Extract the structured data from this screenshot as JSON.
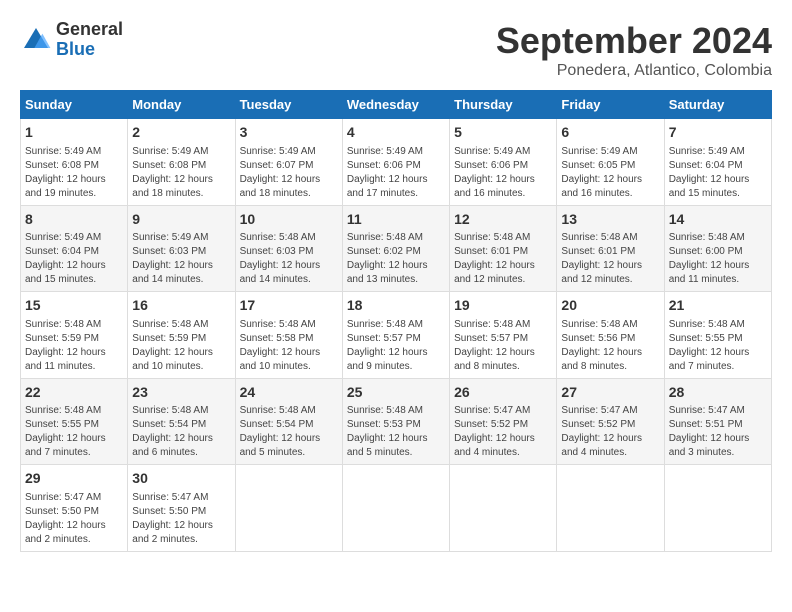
{
  "header": {
    "logo_general": "General",
    "logo_blue": "Blue",
    "month_title": "September 2024",
    "subtitle": "Ponedera, Atlantico, Colombia"
  },
  "weekdays": [
    "Sunday",
    "Monday",
    "Tuesday",
    "Wednesday",
    "Thursday",
    "Friday",
    "Saturday"
  ],
  "weeks": [
    [
      {
        "day": "1",
        "sunrise": "5:49 AM",
        "sunset": "6:08 PM",
        "daylight": "12 hours and 19 minutes."
      },
      {
        "day": "2",
        "sunrise": "5:49 AM",
        "sunset": "6:08 PM",
        "daylight": "12 hours and 18 minutes."
      },
      {
        "day": "3",
        "sunrise": "5:49 AM",
        "sunset": "6:07 PM",
        "daylight": "12 hours and 18 minutes."
      },
      {
        "day": "4",
        "sunrise": "5:49 AM",
        "sunset": "6:06 PM",
        "daylight": "12 hours and 17 minutes."
      },
      {
        "day": "5",
        "sunrise": "5:49 AM",
        "sunset": "6:06 PM",
        "daylight": "12 hours and 16 minutes."
      },
      {
        "day": "6",
        "sunrise": "5:49 AM",
        "sunset": "6:05 PM",
        "daylight": "12 hours and 16 minutes."
      },
      {
        "day": "7",
        "sunrise": "5:49 AM",
        "sunset": "6:04 PM",
        "daylight": "12 hours and 15 minutes."
      }
    ],
    [
      {
        "day": "8",
        "sunrise": "5:49 AM",
        "sunset": "6:04 PM",
        "daylight": "12 hours and 15 minutes."
      },
      {
        "day": "9",
        "sunrise": "5:49 AM",
        "sunset": "6:03 PM",
        "daylight": "12 hours and 14 minutes."
      },
      {
        "day": "10",
        "sunrise": "5:48 AM",
        "sunset": "6:03 PM",
        "daylight": "12 hours and 14 minutes."
      },
      {
        "day": "11",
        "sunrise": "5:48 AM",
        "sunset": "6:02 PM",
        "daylight": "12 hours and 13 minutes."
      },
      {
        "day": "12",
        "sunrise": "5:48 AM",
        "sunset": "6:01 PM",
        "daylight": "12 hours and 12 minutes."
      },
      {
        "day": "13",
        "sunrise": "5:48 AM",
        "sunset": "6:01 PM",
        "daylight": "12 hours and 12 minutes."
      },
      {
        "day": "14",
        "sunrise": "5:48 AM",
        "sunset": "6:00 PM",
        "daylight": "12 hours and 11 minutes."
      }
    ],
    [
      {
        "day": "15",
        "sunrise": "5:48 AM",
        "sunset": "5:59 PM",
        "daylight": "12 hours and 11 minutes."
      },
      {
        "day": "16",
        "sunrise": "5:48 AM",
        "sunset": "5:59 PM",
        "daylight": "12 hours and 10 minutes."
      },
      {
        "day": "17",
        "sunrise": "5:48 AM",
        "sunset": "5:58 PM",
        "daylight": "12 hours and 10 minutes."
      },
      {
        "day": "18",
        "sunrise": "5:48 AM",
        "sunset": "5:57 PM",
        "daylight": "12 hours and 9 minutes."
      },
      {
        "day": "19",
        "sunrise": "5:48 AM",
        "sunset": "5:57 PM",
        "daylight": "12 hours and 8 minutes."
      },
      {
        "day": "20",
        "sunrise": "5:48 AM",
        "sunset": "5:56 PM",
        "daylight": "12 hours and 8 minutes."
      },
      {
        "day": "21",
        "sunrise": "5:48 AM",
        "sunset": "5:55 PM",
        "daylight": "12 hours and 7 minutes."
      }
    ],
    [
      {
        "day": "22",
        "sunrise": "5:48 AM",
        "sunset": "5:55 PM",
        "daylight": "12 hours and 7 minutes."
      },
      {
        "day": "23",
        "sunrise": "5:48 AM",
        "sunset": "5:54 PM",
        "daylight": "12 hours and 6 minutes."
      },
      {
        "day": "24",
        "sunrise": "5:48 AM",
        "sunset": "5:54 PM",
        "daylight": "12 hours and 5 minutes."
      },
      {
        "day": "25",
        "sunrise": "5:48 AM",
        "sunset": "5:53 PM",
        "daylight": "12 hours and 5 minutes."
      },
      {
        "day": "26",
        "sunrise": "5:47 AM",
        "sunset": "5:52 PM",
        "daylight": "12 hours and 4 minutes."
      },
      {
        "day": "27",
        "sunrise": "5:47 AM",
        "sunset": "5:52 PM",
        "daylight": "12 hours and 4 minutes."
      },
      {
        "day": "28",
        "sunrise": "5:47 AM",
        "sunset": "5:51 PM",
        "daylight": "12 hours and 3 minutes."
      }
    ],
    [
      {
        "day": "29",
        "sunrise": "5:47 AM",
        "sunset": "5:50 PM",
        "daylight": "12 hours and 2 minutes."
      },
      {
        "day": "30",
        "sunrise": "5:47 AM",
        "sunset": "5:50 PM",
        "daylight": "12 hours and 2 minutes."
      },
      null,
      null,
      null,
      null,
      null
    ]
  ],
  "labels": {
    "sunrise_prefix": "Sunrise: ",
    "sunset_prefix": "Sunset: ",
    "daylight_prefix": "Daylight: "
  }
}
